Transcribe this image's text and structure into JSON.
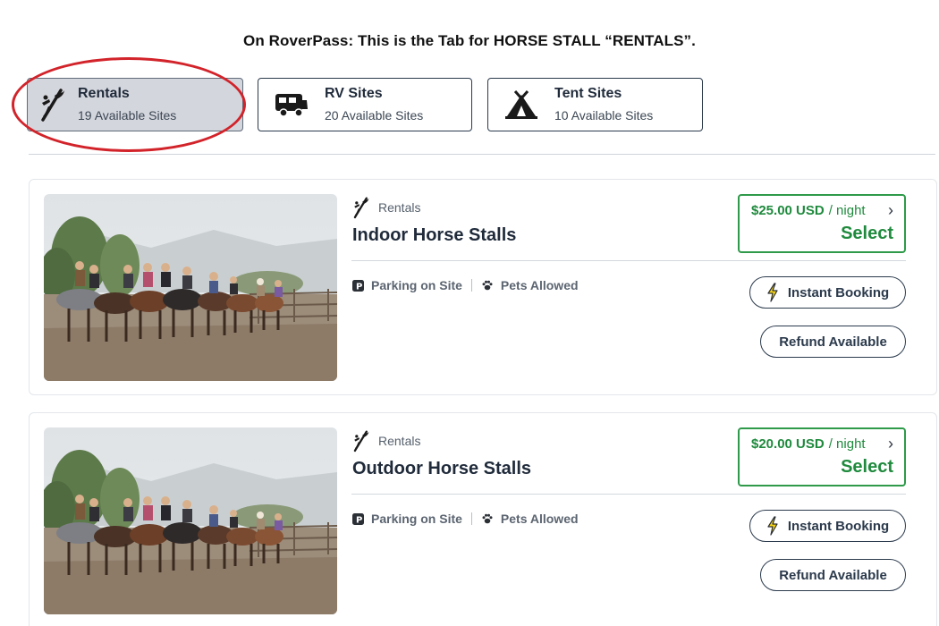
{
  "caption": "On RoverPass: This is the Tab for HORSE STALL “RENTALS”.",
  "tabs": [
    {
      "label": "Rentals",
      "sub": "19 Available Sites",
      "icon": "kayak-icon",
      "active": true
    },
    {
      "label": "RV Sites",
      "sub": "20 Available Sites",
      "icon": "rv-icon",
      "active": false
    },
    {
      "label": "Tent Sites",
      "sub": "10 Available Sites",
      "icon": "tent-icon",
      "active": false
    }
  ],
  "annotation_color": "#d2232a",
  "listings": [
    {
      "category": "Rentals",
      "title": "Indoor Horse Stalls",
      "amenities": [
        "Parking on Site",
        "Pets Allowed"
      ],
      "price": "$25.00 USD",
      "price_unit": "/ night",
      "select_label": "Select",
      "instant_booking": "Instant Booking",
      "refund": "Refund Available"
    },
    {
      "category": "Rentals",
      "title": "Outdoor Horse Stalls",
      "amenities": [
        "Parking on Site",
        "Pets Allowed"
      ],
      "price": "$20.00 USD",
      "price_unit": "/ night",
      "select_label": "Select",
      "instant_booking": "Instant Booking",
      "refund": "Refund Available"
    }
  ],
  "colors": {
    "accent_green": "#1f8a3d",
    "border_dark": "#2b3a4c",
    "active_tab_bg": "#d4d6dd"
  }
}
